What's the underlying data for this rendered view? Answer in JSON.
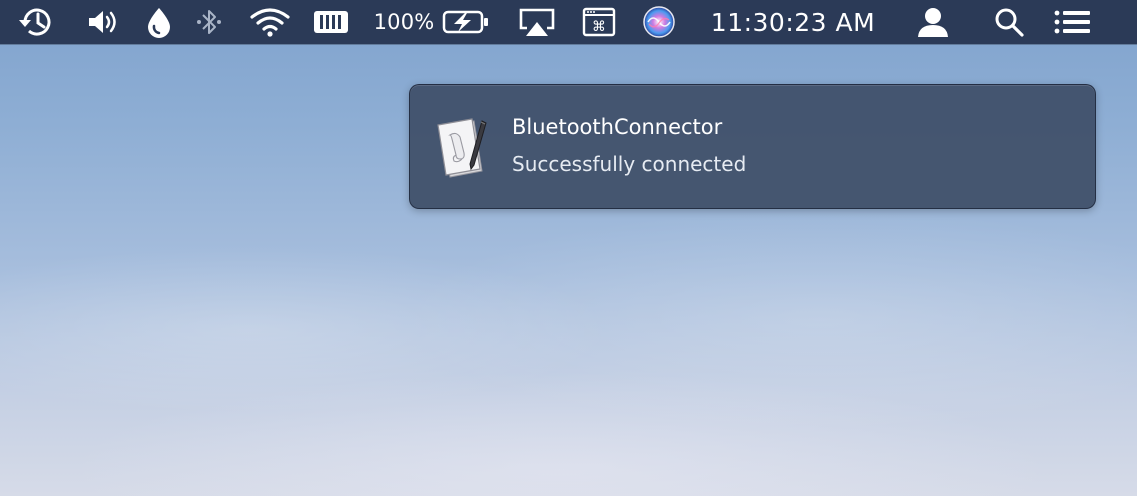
{
  "menubar": {
    "icons": [
      "time-machine-icon",
      "volume-icon",
      "droplet-icon",
      "bluetooth-icon",
      "wifi-icon",
      "memory-icon",
      "battery-icon",
      "airplay-icon",
      "keyboard-viewer-icon",
      "siri-icon",
      "user-icon",
      "spotlight-search-icon",
      "notification-center-icon"
    ],
    "battery_percent": "100%",
    "clock": "11:30:23 AM"
  },
  "notification": {
    "app_icon": "script-editor-icon",
    "title": "BluetoothConnector",
    "message": "Successfully connected"
  },
  "colors": {
    "menubar_bg": "#2b3a57",
    "notification_bg": "#405069",
    "desktop_top": "#7fa2cd",
    "desktop_bottom": "#d6dbe8"
  }
}
